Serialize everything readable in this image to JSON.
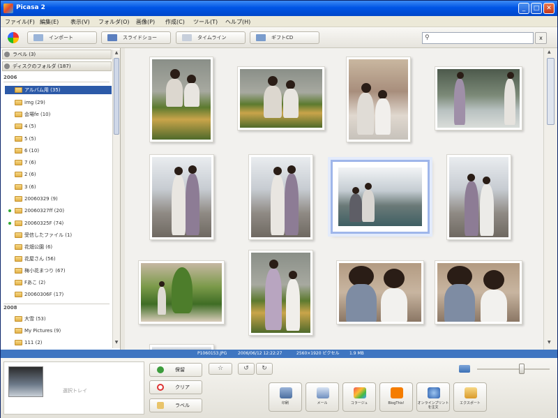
{
  "window": {
    "title": "Picasa 2",
    "buttons": [
      "_",
      "□",
      "✕"
    ]
  },
  "menu": [
    "ファイル(F)",
    "編集(E)",
    "表示(V)",
    "フォルダ(O)",
    "画像(P)",
    "作成(C)",
    "ツール(T)",
    "ヘルプ(H)"
  ],
  "toolbar": {
    "import": "インポート",
    "slideshow": "スライドショー",
    "timeline": "タイムライン",
    "cd": "ギフトCD",
    "search_placeholder": "",
    "clear": "x"
  },
  "sidebar": {
    "labels_header": "ラベル (3)",
    "folders_header": "ディスクのフォルダ (187)",
    "year1": "2006",
    "year2": "2008",
    "folders_2006": [
      "アルバム用 (35)",
      "img (29)",
      "会場fe (10)",
      "4 (5)",
      "5 (5)",
      "6 (10)",
      "7 (6)",
      "2 (6)",
      "3 (6)",
      "20060329 (9)",
      "20060327ff (20)",
      "20060325F (74)",
      "受信したファイル (1)",
      "花畑公園 (6)",
      "花屋さん (56)",
      "梅小花まつり (67)",
      "Fあこ (2)",
      "20060306F (17)"
    ],
    "folders_2008": [
      "大雪 (53)",
      "My Pictures (9)",
      "111 (2)"
    ]
  },
  "status": {
    "filename": "P1060153.JPG",
    "datetime": "2006/06/12 12:22:27",
    "dimensions": "2560×1920 ピクセル",
    "size": "1.9 MB"
  },
  "tray": {
    "label": "選択トレイ"
  },
  "tray_buttons": {
    "hold": "保留",
    "clear": "クリア",
    "label": "ラベル"
  },
  "actions": {
    "print": "印刷",
    "email": "メール",
    "collage": "コラージュ",
    "blog": "BlogThis!",
    "order": "オンラインプリントを注文",
    "export": "エクスポート"
  }
}
